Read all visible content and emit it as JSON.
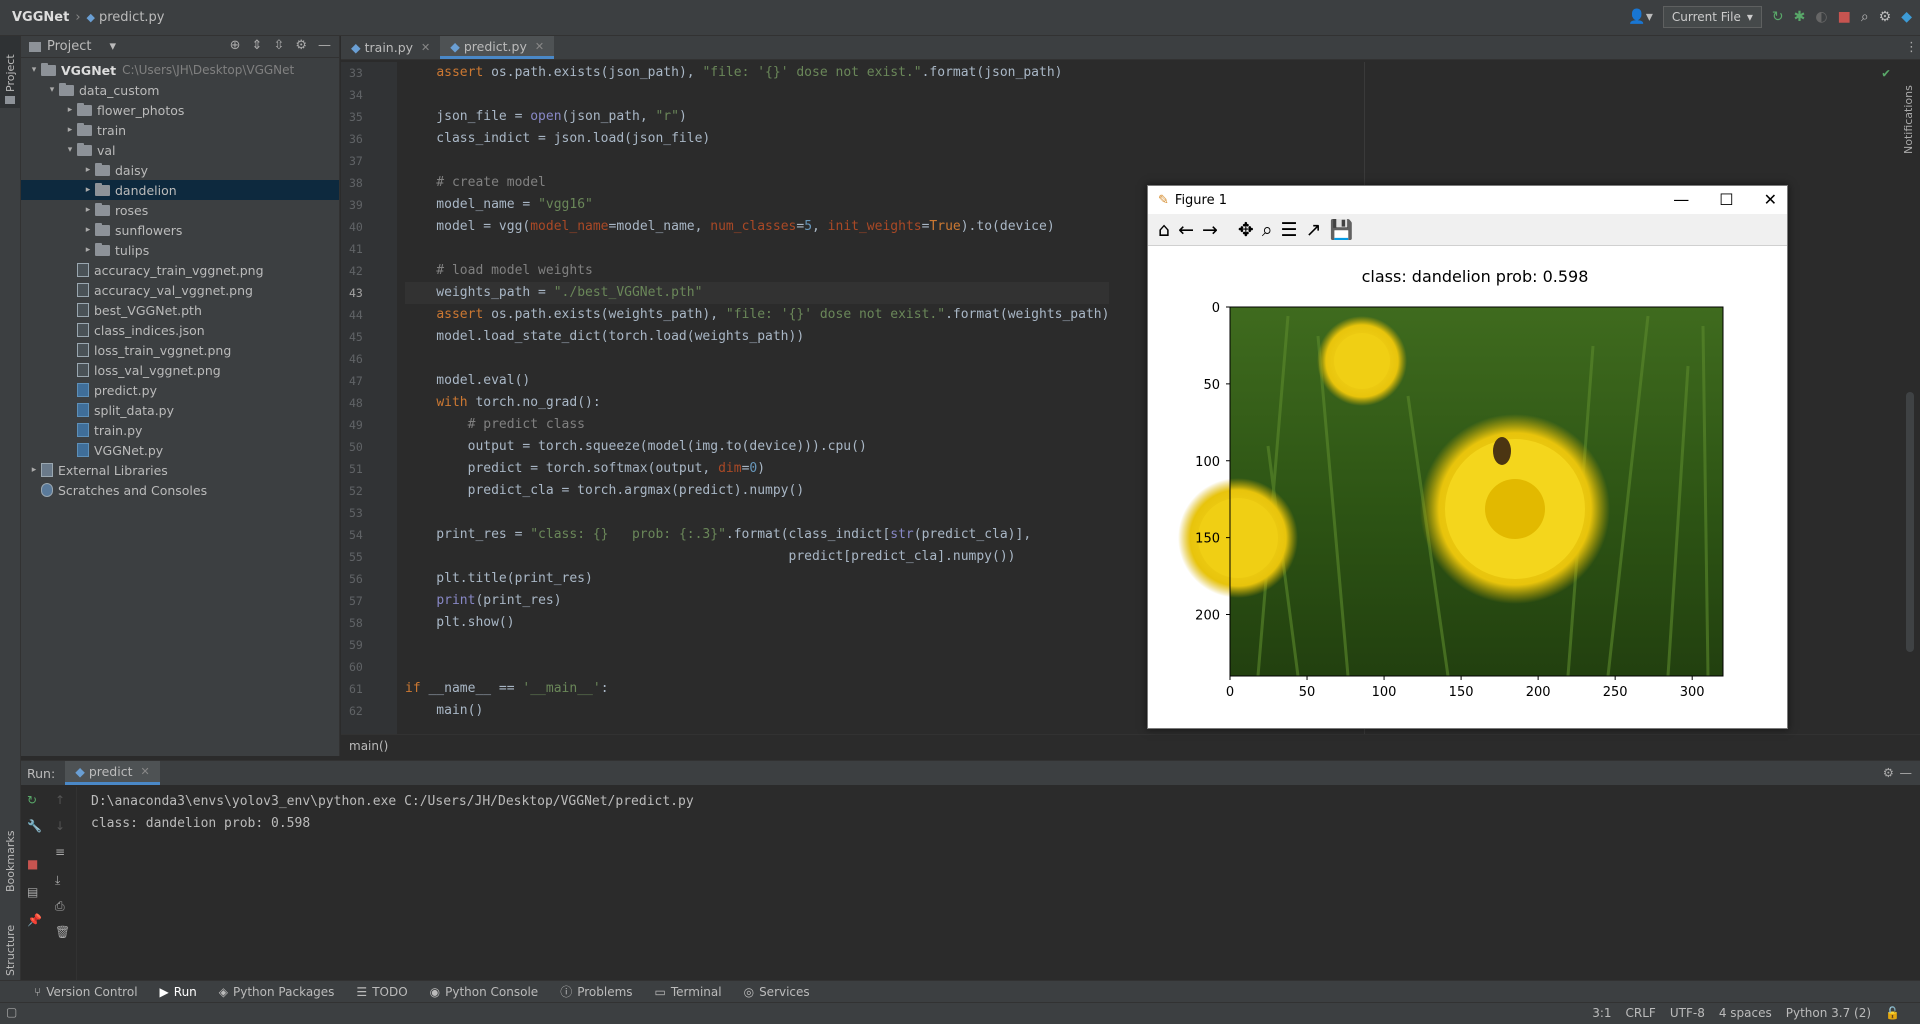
{
  "titlebar": {
    "project": "VGGNet",
    "file": "predict.py",
    "run_config": "Current File"
  },
  "leftstrip": {
    "project_label": "Project",
    "bookmarks_label": "Bookmarks",
    "structure_label": "Structure"
  },
  "project_panel": {
    "header": "Project",
    "tree": [
      {
        "label": "VGGNet",
        "note": "C:\\Users\\JH\\Desktop\\VGGNet",
        "type": "folder",
        "depth": 0,
        "open": true,
        "bold": true
      },
      {
        "label": "data_custom",
        "type": "folder",
        "depth": 1,
        "open": true
      },
      {
        "label": "flower_photos",
        "type": "folder",
        "depth": 2,
        "open": false
      },
      {
        "label": "train",
        "type": "folder",
        "depth": 2,
        "open": false
      },
      {
        "label": "val",
        "type": "folder",
        "depth": 2,
        "open": true
      },
      {
        "label": "daisy",
        "type": "folder",
        "depth": 3,
        "open": false
      },
      {
        "label": "dandelion",
        "type": "folder",
        "depth": 3,
        "open": false,
        "selected": true
      },
      {
        "label": "roses",
        "type": "folder",
        "depth": 3,
        "open": false
      },
      {
        "label": "sunflowers",
        "type": "folder",
        "depth": 3,
        "open": false
      },
      {
        "label": "tulips",
        "type": "folder",
        "depth": 3,
        "open": false
      },
      {
        "label": "accuracy_train_vggnet.png",
        "type": "file",
        "depth": 2
      },
      {
        "label": "accuracy_val_vggnet.png",
        "type": "file",
        "depth": 2
      },
      {
        "label": "best_VGGNet.pth",
        "type": "file",
        "depth": 2
      },
      {
        "label": "class_indices.json",
        "type": "file",
        "depth": 2
      },
      {
        "label": "loss_train_vggnet.png",
        "type": "file",
        "depth": 2
      },
      {
        "label": "loss_val_vggnet.png",
        "type": "file",
        "depth": 2
      },
      {
        "label": "predict.py",
        "type": "py",
        "depth": 2
      },
      {
        "label": "split_data.py",
        "type": "py",
        "depth": 2
      },
      {
        "label": "train.py",
        "type": "py",
        "depth": 2
      },
      {
        "label": "VGGNet.py",
        "type": "py",
        "depth": 2
      },
      {
        "label": "External Libraries",
        "type": "lib",
        "depth": 0,
        "open": false
      },
      {
        "label": "Scratches and Consoles",
        "type": "scratch",
        "depth": 0
      }
    ]
  },
  "tabs": [
    {
      "label": "train.py",
      "active": false
    },
    {
      "label": "predict.py",
      "active": true
    }
  ],
  "code": {
    "start_line": 33,
    "current_line": 43,
    "lines": [
      "    assert os.path.exists(json_path), \"file: '{}' dose not exist.\".format(json_path)",
      "",
      "    json_file = open(json_path, \"r\")",
      "    class_indict = json.load(json_file)",
      "",
      "    # create model",
      "    model_name = \"vgg16\"",
      "    model = vgg(model_name=model_name, num_classes=5, init_weights=True).to(device)",
      "",
      "    # load model weights",
      "    weights_path = \"./best_VGGNet.pth\"",
      "    assert os.path.exists(weights_path), \"file: '{}' dose not exist.\".format(weights_path)",
      "    model.load_state_dict(torch.load(weights_path))",
      "",
      "    model.eval()",
      "    with torch.no_grad():",
      "        # predict class",
      "        output = torch.squeeze(model(img.to(device))).cpu()",
      "        predict = torch.softmax(output, dim=0)",
      "        predict_cla = torch.argmax(predict).numpy()",
      "",
      "    print_res = \"class: {}   prob: {:.3}\".format(class_indict[str(predict_cla)],",
      "                                                 predict[predict_cla].numpy())",
      "    plt.title(print_res)",
      "    print(print_res)",
      "    plt.show()",
      "",
      "",
      "if __name__ == '__main__':",
      "    main()"
    ],
    "breadcrumb": "main()"
  },
  "run": {
    "label": "Run:",
    "tab": "predict",
    "output": [
      "D:\\anaconda3\\envs\\yolov3_env\\python.exe C:/Users/JH/Desktop/VGGNet/predict.py",
      "class: dandelion   prob: 0.598"
    ]
  },
  "bottom_tabs": [
    "Version Control",
    "Run",
    "Python Packages",
    "TODO",
    "Python Console",
    "Problems",
    "Terminal",
    "Services"
  ],
  "status": {
    "position": "3:1",
    "line_sep": "CRLF",
    "encoding": "UTF-8",
    "indent": "4 spaces",
    "interpreter": "Python 3.7 (2)"
  },
  "figure": {
    "window_title": "Figure 1",
    "plot_title": "class: dandelion   prob: 0.598",
    "x_ticks": [
      "0",
      "50",
      "100",
      "150",
      "200",
      "250",
      "300"
    ],
    "y_ticks": [
      "0",
      "50",
      "100",
      "150",
      "200"
    ],
    "image_width": 320,
    "image_height": 240,
    "image_desc": "yellow-dandelion-with-bee"
  }
}
